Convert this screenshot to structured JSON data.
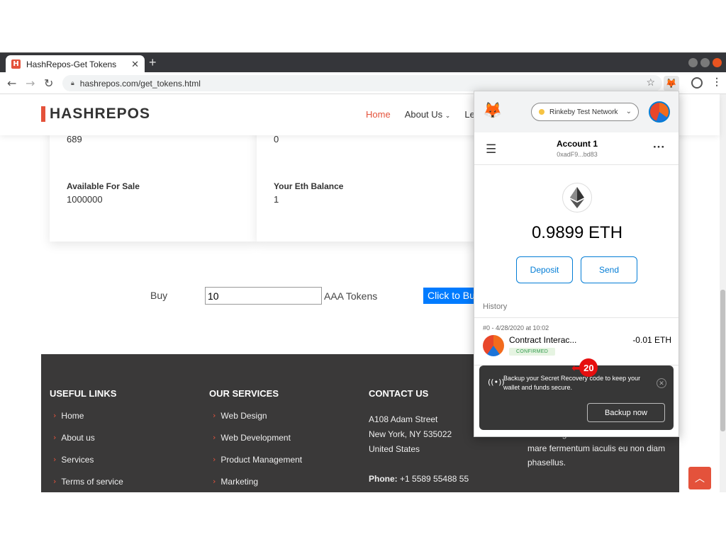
{
  "browser": {
    "tab_title": "HashRepos-Get Tokens",
    "favicon_letter": "H",
    "url": "hashrepos.com/get_tokens.html"
  },
  "site": {
    "logo": "HASHREPOS",
    "menu": {
      "home": "Home",
      "about": "About Us",
      "partial": "Le"
    },
    "cards": [
      {
        "top_value": "689",
        "label": "Available For Sale",
        "value": "1000000"
      },
      {
        "top_value": "0",
        "label": "Your Eth Balance",
        "value": "1"
      }
    ],
    "buy": {
      "label": "Buy",
      "amount": "10",
      "unit": "AAA Tokens",
      "button": "Click to Buy"
    }
  },
  "footer": {
    "useful_links": {
      "title": "USEFUL LINKS",
      "items": [
        "Home",
        "About us",
        "Services",
        "Terms of service"
      ]
    },
    "services": {
      "title": "OUR SERVICES",
      "items": [
        "Web Design",
        "Web Development",
        "Product Management",
        "Marketing"
      ]
    },
    "contact": {
      "title": "CONTACT US",
      "street": "A108 Adam Street",
      "city": "New York, NY 535022",
      "country": "United States",
      "phone_label": "Phone:",
      "phone": "+1 5589 55488 55"
    },
    "about_text": [
      "videa magna derita valies darta donna",
      "mare fermentum iaculis eu non diam",
      "phasellus."
    ]
  },
  "metamask": {
    "network": "Rinkeby Test Network",
    "account_name": "Account 1",
    "account_address": "0xadF9...bd83",
    "balance": "0.9899 ETH",
    "deposit": "Deposit",
    "send": "Send",
    "history_label": "History",
    "transaction": {
      "date": "#0 - 4/28/2020 at 10:02",
      "name": "Contract Interac...",
      "amount": "-0.01 ETH",
      "status": "CONFIRMED"
    },
    "toast": {
      "message": "Backup your Secret Recovery code to keep your wallet and funds secure.",
      "button": "Backup now"
    }
  },
  "annotation_badge": "20",
  "colors": {
    "accent": "#e4523b",
    "metamask_blue": "#037dd6",
    "buy_button": "#007bff",
    "footer_bg": "#3a3939"
  }
}
